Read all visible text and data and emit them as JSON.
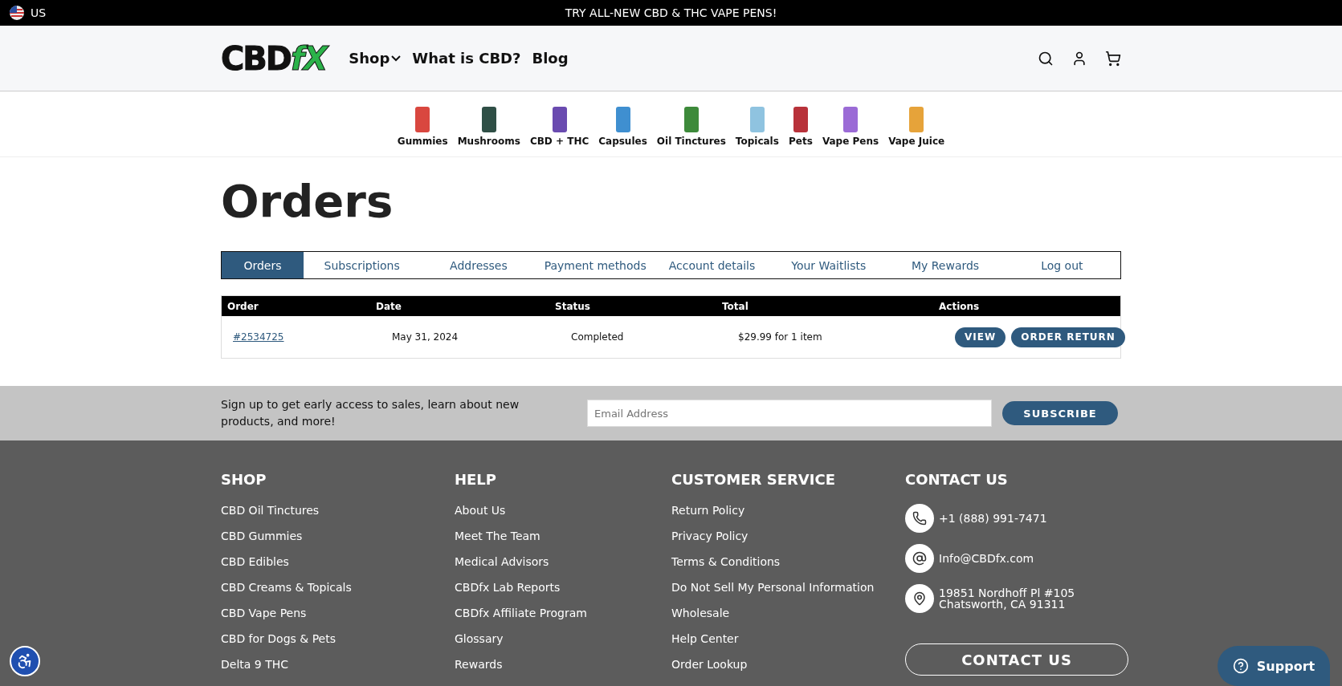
{
  "top_bar": {
    "region": "US",
    "promo": "TRY ALL-NEW CBD & THC VAPE PENS!"
  },
  "header": {
    "logo": {
      "main": "CBD",
      "accent": "fX"
    },
    "nav": [
      {
        "label": "Shop",
        "dropdown": true
      },
      {
        "label": "What is CBD?",
        "dropdown": false
      },
      {
        "label": "Blog",
        "dropdown": false
      }
    ]
  },
  "categories": [
    {
      "label": "Gummies",
      "color": "#d9473f"
    },
    {
      "label": "Mushrooms",
      "color": "#2f4f46"
    },
    {
      "label": "CBD + THC",
      "color": "#6a4bb0"
    },
    {
      "label": "Capsules",
      "color": "#3f8fd0"
    },
    {
      "label": "Oil Tinctures",
      "color": "#3d8a3a"
    },
    {
      "label": "Topicals",
      "color": "#8fc3e0"
    },
    {
      "label": "Pets",
      "color": "#b8323a"
    },
    {
      "label": "Vape Pens",
      "color": "#9b6bd6"
    },
    {
      "label": "Vape Juice",
      "color": "#e6a33a"
    }
  ],
  "page_title": "Orders",
  "tabs": [
    {
      "label": "Orders",
      "selected": true
    },
    {
      "label": "Subscriptions",
      "selected": false
    },
    {
      "label": "Addresses",
      "selected": false
    },
    {
      "label": "Payment methods",
      "selected": false
    },
    {
      "label": "Account details",
      "selected": false
    },
    {
      "label": "Your Waitlists",
      "selected": false
    },
    {
      "label": "My Rewards",
      "selected": false
    },
    {
      "label": "Log out",
      "selected": false
    }
  ],
  "table": {
    "columns": [
      "Order",
      "Date",
      "Status",
      "Total",
      "Actions"
    ],
    "rows": [
      {
        "order": "#2534725",
        "date": "May 31, 2024",
        "status": "Completed",
        "total": "$29.99 for 1 item",
        "actions": [
          "VIEW",
          "ORDER RETURN"
        ]
      }
    ]
  },
  "signup": {
    "text": "Sign up to get early access to sales, learn about new products, and more!",
    "placeholder": "Email Address",
    "button": "SUBSCRIBE"
  },
  "footer": {
    "columns": [
      {
        "title": "SHOP",
        "links": [
          "CBD Oil Tinctures",
          "CBD Gummies",
          "CBD Edibles",
          "CBD Creams & Topicals",
          "CBD Vape Pens",
          "CBD for Dogs & Pets",
          "Delta 9 THC"
        ]
      },
      {
        "title": "HELP",
        "links": [
          "About Us",
          "Meet The Team",
          "Medical Advisors",
          "CBDfx Lab Reports",
          "CBDfx Affiliate Program",
          "Glossary",
          "Rewards"
        ]
      },
      {
        "title": "CUSTOMER SERVICE",
        "links": [
          "Return Policy",
          "Privacy Policy",
          "Terms & Conditions",
          "Do Not Sell My Personal Information",
          "Wholesale",
          "Help Center",
          "Order Lookup"
        ]
      }
    ],
    "contact": {
      "title": "CONTACT US",
      "items": [
        {
          "kind": "phone",
          "lines": [
            "+1 (888) 991-7471"
          ]
        },
        {
          "kind": "email",
          "lines": [
            "Info@CBDfx.com"
          ]
        },
        {
          "kind": "address",
          "lines": [
            "19851 Nordhoff Pl #105",
            "Chatsworth, CA 91311"
          ]
        }
      ],
      "button": "CONTACT US"
    }
  },
  "support_button": "Support"
}
